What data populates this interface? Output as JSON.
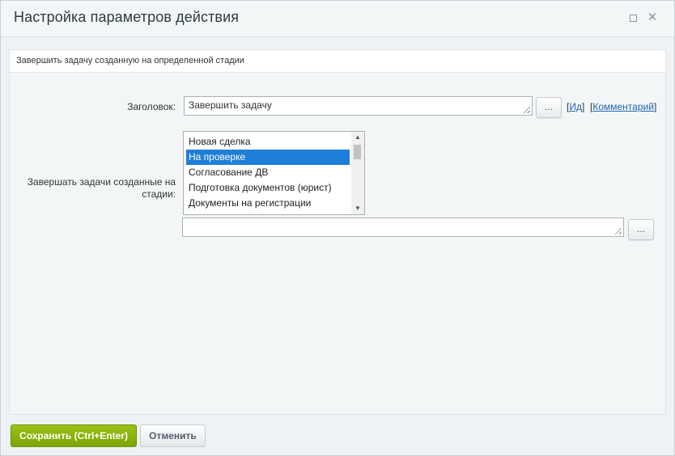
{
  "dialog": {
    "title": "Настройка параметров действия",
    "maximize_icon": "maximize-icon",
    "close_icon": "close-icon",
    "close_glyph": "✕"
  },
  "section": {
    "header": "Завершить задачу созданную на определенной стадии"
  },
  "form": {
    "title_label": "Заголовок:",
    "title_value": "Завершить задачу",
    "dots_label": "...",
    "link_id_open": "[",
    "link_id": "Ид",
    "link_id_close": "]",
    "link_comment_open": "[",
    "link_comment": "Комментарий",
    "link_comment_close": "]",
    "stage_label": "Завершать задачи созданные на стадии:",
    "stage_options": [
      "Новая сделка",
      "На проверке",
      "Согласование ДВ",
      "Подготовка документов (юрист)",
      "Документы на регистрации"
    ],
    "stage_selected": "На проверке",
    "extra_value": ""
  },
  "footer": {
    "save_label": "Сохранить (Ctrl+Enter)",
    "cancel_label": "Отменить"
  },
  "colors": {
    "accent_green": "#7da400",
    "selection_blue": "#1e7fd8",
    "link_blue": "#2067b0"
  }
}
